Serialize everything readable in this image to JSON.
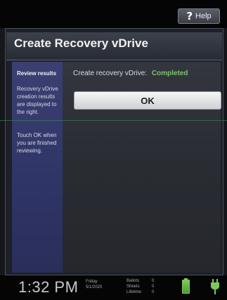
{
  "topbar": {
    "help_label": "Help",
    "help_icon": "?"
  },
  "window": {
    "title": "Create Recovery vDrive"
  },
  "sidebar": {
    "heading": "Review results",
    "paragraphs": [
      "Recovery vDrive creation results are displayed to the right.",
      "Touch OK when you are finished reviewing."
    ]
  },
  "main": {
    "status_label": "Create recovery vDrive:",
    "status_value": "Completed",
    "ok_label": "OK"
  },
  "statusbar": {
    "time": "1:32 PM",
    "day": "Friday",
    "date": "5/1/2020",
    "counts": [
      {
        "label": "Ballots",
        "value": "0"
      },
      {
        "label": "Sheets",
        "value": "0"
      },
      {
        "label": "Lifetime",
        "value": "0"
      }
    ]
  },
  "colors": {
    "completed": "#7cc36c",
    "battery": "#7ec85a"
  }
}
